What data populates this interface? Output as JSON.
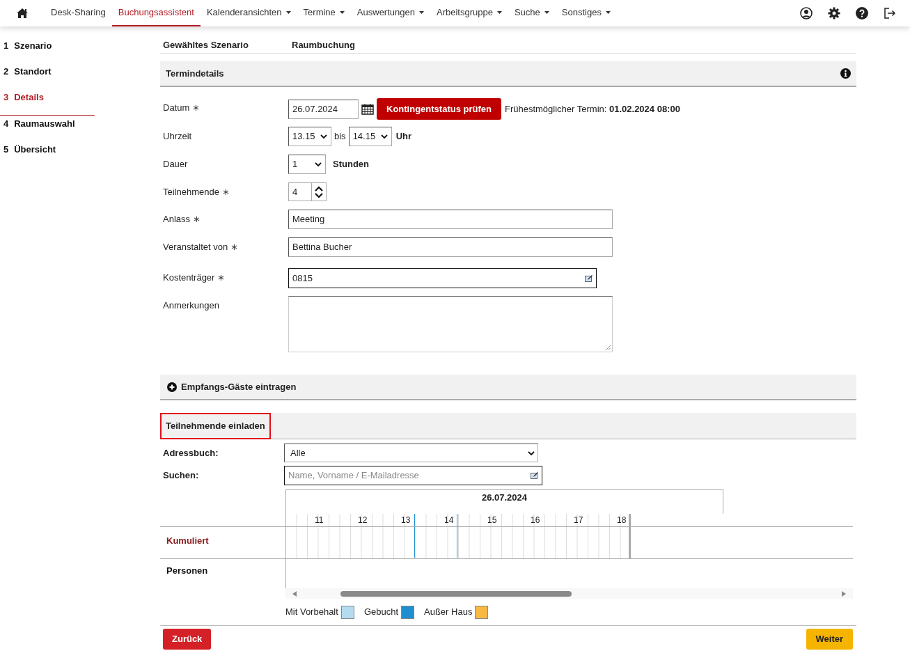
{
  "nav": {
    "items": [
      {
        "label": "Desk-Sharing",
        "selected": false,
        "dropdown": false
      },
      {
        "label": "Buchungsassistent",
        "selected": true,
        "dropdown": false
      },
      {
        "label": "Kalenderansichten",
        "selected": false,
        "dropdown": true
      },
      {
        "label": "Termine",
        "selected": false,
        "dropdown": true
      },
      {
        "label": "Auswertungen",
        "selected": false,
        "dropdown": true
      },
      {
        "label": "Arbeitsgruppe",
        "selected": false,
        "dropdown": true
      },
      {
        "label": "Suche",
        "selected": false,
        "dropdown": true
      },
      {
        "label": "Sonstiges",
        "selected": false,
        "dropdown": true
      }
    ]
  },
  "steps": [
    {
      "number": "1",
      "label": "Szenario",
      "selected": false
    },
    {
      "number": "2",
      "label": "Standort",
      "selected": false
    },
    {
      "number": "3",
      "label": "Details",
      "selected": true
    },
    {
      "number": "4",
      "label": "Raumauswahl",
      "selected": false
    },
    {
      "number": "5",
      "label": "Übersicht",
      "selected": false
    }
  ],
  "scenario": {
    "label": "Gewähltes Szenario",
    "value": "Raumbuchung"
  },
  "termindetails": {
    "title": "Termindetails",
    "fields": [
      {
        "kind": "date",
        "label": "Datum",
        "marker": "∗",
        "value": "26.07.2024",
        "button": "Kontingentstatus prüfen",
        "note": "Frühestmöglicher Termin: **01.02.2024 08:00**"
      },
      {
        "kind": "time_range",
        "label": "Uhrzeit",
        "from": "13.15",
        "separator": "bis",
        "to": "14.15",
        "unit": "Uhr"
      },
      {
        "kind": "duration",
        "label": "Dauer",
        "value": "1",
        "unit": "Stunden"
      },
      {
        "kind": "number",
        "label": "Teilnehmende",
        "marker": "∗",
        "value": "4"
      },
      {
        "kind": "text",
        "label": "Anlass",
        "marker": "∗",
        "value": "Meeting"
      },
      {
        "kind": "text",
        "label": "Veranstaltet von",
        "marker": "∗",
        "value": "Bettina Bucher"
      },
      {
        "kind": "text_edit",
        "label": "Kostenträger",
        "marker": "∗",
        "value": "0815"
      },
      {
        "kind": "textarea",
        "label": "Anmerkungen"
      }
    ]
  },
  "guests": {
    "title": "Empfangs-Gäste eintragen",
    "expanded": false
  },
  "invite": {
    "title": "Teilnehmende einladen",
    "addressbook": {
      "label": "Adressbuch:",
      "value": "Alle"
    },
    "search": {
      "label": "Suchen:",
      "placeholder": "Name, Vorname / E-Mailadresse"
    }
  },
  "timeline": {
    "date": "26.07.2024",
    "hours": [
      "11",
      "12",
      "13",
      "14",
      "15",
      "16",
      "17",
      "18"
    ],
    "rows": [
      {
        "label": "Kumuliert",
        "kind": "summary"
      },
      {
        "label": "Personen",
        "kind": "people"
      }
    ],
    "legend": [
      {
        "label": "Mit Vorbehalt",
        "color": "#b3dcf0"
      },
      {
        "label": "Gebucht",
        "color": "#1f8fcf"
      },
      {
        "label": "Außer Haus",
        "color": "#f7b944"
      }
    ]
  },
  "buttons": {
    "back": "Zurück",
    "next": "Weiter"
  }
}
